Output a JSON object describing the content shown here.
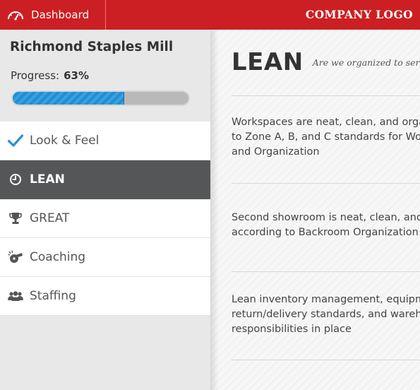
{
  "header": {
    "dashboard_label": "Dashboard",
    "logo_text": "COMPANY LOGO",
    "dashboard_icon": "speedometer-icon",
    "brand_color": "#cc1f24"
  },
  "sidebar": {
    "site_name": "Richmond Staples Mill",
    "progress_label": "Progress:",
    "progress_value": "63%",
    "progress_fraction": 0.63,
    "progress_color": "#1e8fd6",
    "items": [
      {
        "label": "Look & Feel",
        "icon": "checkmark-icon",
        "active": false
      },
      {
        "label": "LEAN",
        "icon": "clock-icon",
        "active": true
      },
      {
        "label": "GREAT",
        "icon": "trophy-icon",
        "active": false
      },
      {
        "label": "Coaching",
        "icon": "whistle-icon",
        "active": false
      },
      {
        "label": "Staffing",
        "icon": "group-icon",
        "active": false
      }
    ]
  },
  "main": {
    "title": "LEAN",
    "subtitle": "Are we organized to serve our",
    "statements": [
      {
        "text": "Workspaces are neat, clean, and organ\nto Zone A, B, and C standards for Work\nand Organization"
      },
      {
        "text": "Second showroom is neat, clean, and o\naccording to Backroom Organization s"
      },
      {
        "text": "Lean inventory management, equipme\nreturn/delivery standards, and wareho\nresponsibilities in place"
      }
    ]
  }
}
